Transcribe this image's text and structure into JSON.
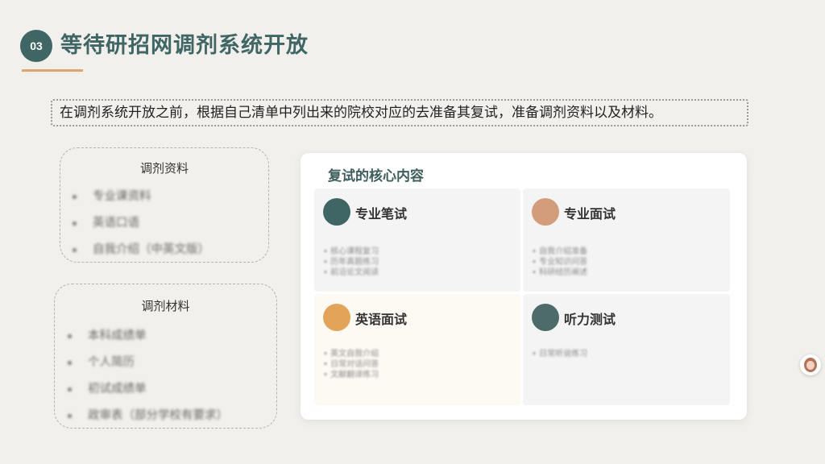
{
  "header": {
    "badge": "03",
    "title": "等待研招网调剂系统开放"
  },
  "intro_text": "在调剂系统开放之前，根据自己清单中列出来的院校对应的去准备其复试，准备调剂资料以及材料。",
  "left_cards": [
    {
      "title": "调剂资料",
      "items": [
        "专业课资料",
        "英语口语",
        "自我介绍（中英文版）"
      ]
    },
    {
      "title": "调剂材料",
      "items": [
        "本科成绩单",
        "个人简历",
        "初试成绩单",
        "政审表（部分学校有要求）"
      ]
    }
  ],
  "core_panel": {
    "title": "复试的核心内容",
    "quadrants": [
      {
        "label": "专业笔试",
        "color": "#3f6664",
        "items": [
          "• 核心课程复习",
          "• 历年真题练习",
          "• 前沿论文阅读"
        ]
      },
      {
        "label": "专业面试",
        "color": "#d39c7a",
        "items": [
          "• 自我介绍准备",
          "• 专业知识问答",
          "• 科研经历阐述"
        ]
      },
      {
        "label": "英语面试",
        "color": "#e3a45a",
        "items": [
          "• 英文自我介绍",
          "• 日常对话问答",
          "• 文献翻译练习"
        ]
      },
      {
        "label": "听力测试",
        "color": "#4c6b69",
        "items": [
          "• 日常听说练习"
        ]
      }
    ]
  }
}
